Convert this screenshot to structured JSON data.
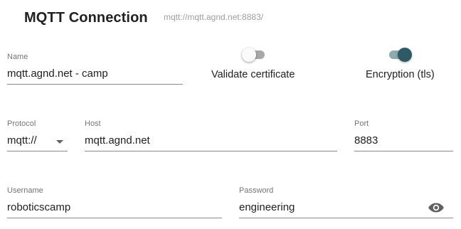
{
  "header": {
    "title": "MQTT Connection",
    "url": "mqtt://mqtt.agnd.net:8883/"
  },
  "name_field": {
    "label": "Name",
    "value": "mqtt.agnd.net - camp"
  },
  "validate_certificate": {
    "label": "Validate certificate",
    "enabled": false
  },
  "encryption": {
    "label": "Encryption (tls)",
    "enabled": true
  },
  "protocol_field": {
    "label": "Protocol",
    "value": "mqtt://"
  },
  "host_field": {
    "label": "Host",
    "value": "mqtt.agnd.net"
  },
  "port_field": {
    "label": "Port",
    "value": "8883"
  },
  "username_field": {
    "label": "Username",
    "value": "roboticscamp"
  },
  "password_field": {
    "label": "Password",
    "value": "engineering",
    "visibility_icon": "eye-icon"
  },
  "colors": {
    "accent": "#2e5a66",
    "accent_track": "#8fa9b1"
  }
}
